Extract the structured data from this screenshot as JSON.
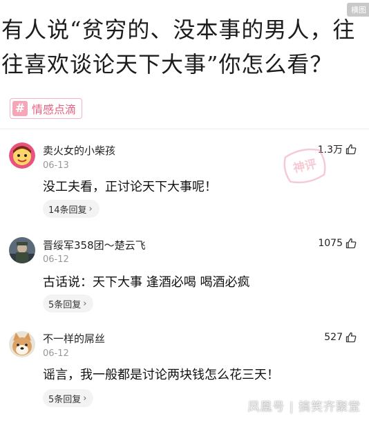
{
  "corner_badge": "横图",
  "title": "有人说“贫穷的、没本事的男人，往往喜欢谈论天下大事”你怎么看？",
  "topic": {
    "hash": "#",
    "label": "情感点滴"
  },
  "stamp_text": "神评",
  "comments": [
    {
      "username": "卖火女的小柴孩",
      "date": "06-13",
      "content": "没工夫看，正讨论天下大事呢！",
      "replies": "14条回复",
      "likes": "1.3万",
      "avatar": "cartoon-face-avatar"
    },
    {
      "username": "晋绥军358团〜楚云飞",
      "date": "06-12",
      "content": "古话说：天下大事 逢酒必喝 喝酒必疯",
      "replies": "5条回复",
      "likes": "1075",
      "avatar": "soldier-photo-avatar"
    },
    {
      "username": "不一样的屌丝",
      "date": "06-12",
      "content": "谣言，我一般都是讨论两块钱怎么花三天！",
      "replies": "5条回复",
      "likes": "527",
      "avatar": "shiba-dog-avatar"
    }
  ],
  "watermark": "凤凰号 | 搞笑齐聚堂",
  "colors": {
    "accent_pink": "#e8607f",
    "tag_border": "#f3b3c0",
    "stamp": "#f0a0b4"
  }
}
